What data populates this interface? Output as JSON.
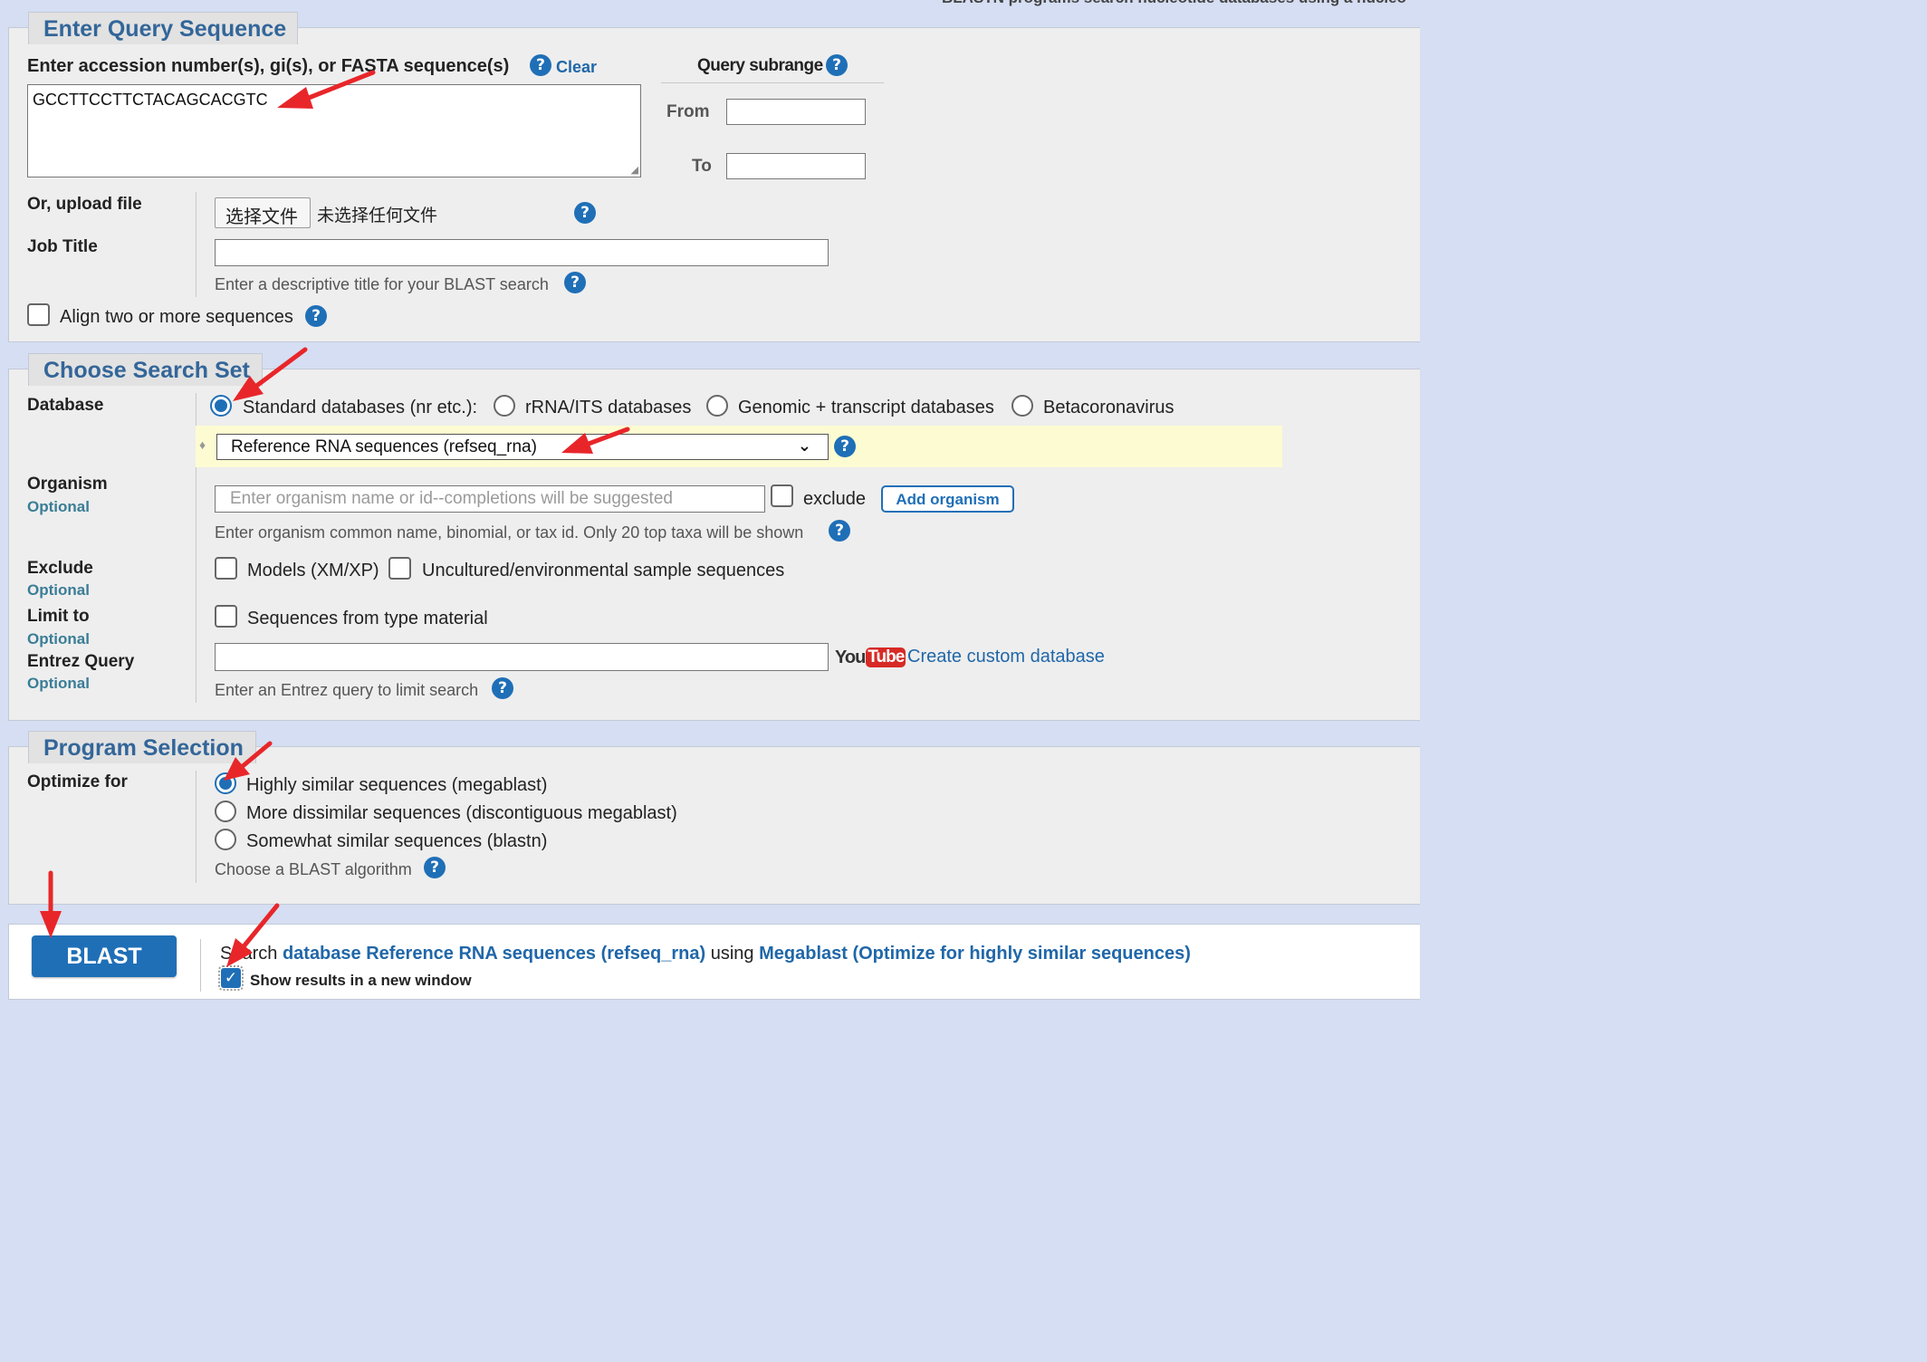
{
  "header_note": "BLASTN programs search nucleotide databases using a nucleo",
  "query": {
    "tab_title": "Enter Query Sequence",
    "sequence_label": "Enter accession number(s), gi(s), or FASTA sequence(s)",
    "clear_label": "Clear",
    "sequence_value": "GCCTTCCTTCTACAGCACGTC",
    "subrange_title": "Query subrange",
    "from_label": "From",
    "to_label": "To",
    "upload_label": "Or, upload file",
    "choose_file_button": "选择文件",
    "no_file_text": "未选择任何文件",
    "job_title_label": "Job Title",
    "job_title_hint": "Enter a descriptive title for your BLAST search",
    "align_two_label": "Align two or more sequences"
  },
  "search_set": {
    "tab_title": "Choose Search Set",
    "database_label": "Database",
    "db_options": [
      "Standard databases (nr etc.):",
      "rRNA/ITS databases",
      "Genomic + transcript databases",
      "Betacoronavirus"
    ],
    "db_selected": "Standard databases (nr etc.):",
    "db_select_value": "Reference RNA sequences (refseq_rna)",
    "organism_label": "Organism",
    "optional_label": "Optional",
    "organism_placeholder": "Enter organism name or id--completions will be suggested",
    "exclude_label_inline": "exclude",
    "add_organism_button": "Add organism",
    "organism_hint": "Enter organism common name, binomial, or tax id. Only 20 top taxa will be shown",
    "exclude_label": "Exclude",
    "exclude_models": "Models (XM/XP)",
    "exclude_uncultured": "Uncultured/environmental sample sequences",
    "limit_label": "Limit to",
    "limit_type_material": "Sequences from type material",
    "entrez_label": "Entrez Query",
    "youtube_you": "You",
    "youtube_tube": "Tube",
    "custom_db_link": "Create custom database",
    "entrez_hint": "Enter an Entrez query to limit search"
  },
  "program": {
    "tab_title": "Program Selection",
    "optimize_label": "Optimize for",
    "options": [
      "Highly similar sequences (megablast)",
      "More dissimilar sequences (discontiguous megablast)",
      "Somewhat similar sequences (blastn)"
    ],
    "selected": "Highly similar sequences (megablast)",
    "algorithm_hint": "Choose a BLAST algorithm"
  },
  "submit": {
    "blast_button": "BLAST",
    "summary_prefix": "Search",
    "summary_db": "database Reference RNA sequences (refseq_rna)",
    "summary_using": "using",
    "summary_program": "Megablast (Optimize for highly similar sequences)",
    "new_window_label": "Show results in a new window",
    "new_window_checked": true
  },
  "colors": {
    "accent_blue": "#1f6fb7",
    "heading_blue": "#336699",
    "annotation_red": "#e8262a",
    "page_bg": "#d5def2",
    "panel_bg": "#eeeeee"
  }
}
